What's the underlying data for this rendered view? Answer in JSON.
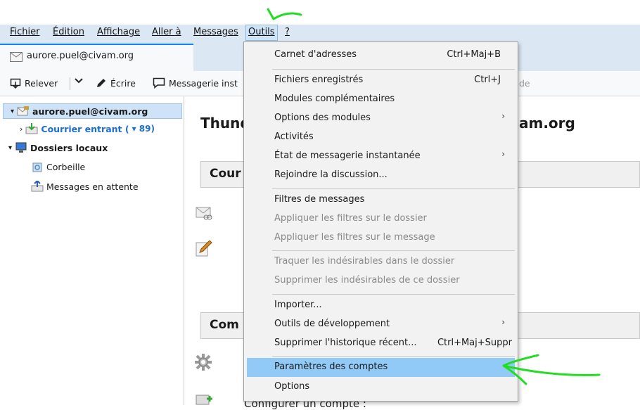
{
  "menubar": {
    "items": [
      {
        "label": "Fichier"
      },
      {
        "label": "Édition"
      },
      {
        "label": "Affichage"
      },
      {
        "label": "Aller à"
      },
      {
        "label": "Messages"
      },
      {
        "label": "Outils"
      },
      {
        "label": "?"
      }
    ]
  },
  "tab": {
    "label": "aurore.puel@civam.org"
  },
  "toolbar": {
    "get_messages": "Relever",
    "write": "Écrire",
    "chat": "Messagerie inst",
    "truncated_right": "de"
  },
  "folders": {
    "account": "aurore.puel@civam.org",
    "inbox": "Courrier entrant (",
    "inbox_count": "▾ 89)",
    "local": "Dossiers locaux",
    "trash": "Corbeille",
    "outbox": "Messages en attente"
  },
  "main": {
    "title_left": "Thund",
    "title_right": "am.org",
    "section1": "Cour",
    "section2": "Com",
    "configure": "Configurer un compte :"
  },
  "menu": {
    "items": [
      {
        "label": "Carnet d'adresses",
        "shortcut": "Ctrl+Maj+B"
      },
      {
        "label": "Fichiers enregistrés",
        "shortcut": "Ctrl+J"
      },
      {
        "label": "Modules complémentaires"
      },
      {
        "label": "Options des modules"
      },
      {
        "label": "Activités"
      },
      {
        "label": "État de messagerie instantanée"
      },
      {
        "label": "Rejoindre la discussion..."
      },
      {
        "label": "Filtres de messages"
      },
      {
        "label": "Appliquer les filtres sur le dossier"
      },
      {
        "label": "Appliquer les filtres sur le message"
      },
      {
        "label": "Traquer les indésirables dans le dossier"
      },
      {
        "label": "Supprimer les indésirables de ce dossier"
      },
      {
        "label": "Importer..."
      },
      {
        "label": "Outils de développement"
      },
      {
        "label": "Supprimer l'historique récent...",
        "shortcut": "Ctrl+Maj+Suppr"
      },
      {
        "label": "Paramètres des comptes"
      },
      {
        "label": "Options"
      }
    ]
  },
  "colors": {
    "highlight": "#91c9f7",
    "annotation": "#22dd22",
    "inbox_blue": "#1a6fd1"
  }
}
